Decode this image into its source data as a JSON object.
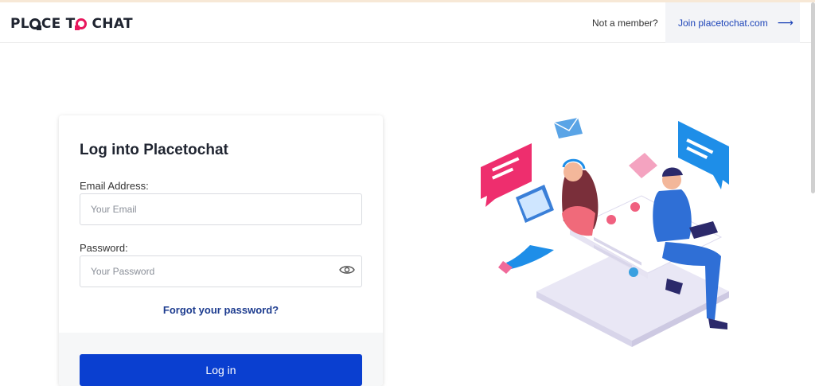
{
  "header": {
    "logo_text": "PLACE TO CHAT",
    "not_member_text": "Not a member?",
    "join_label": "Join placetochat.com",
    "join_arrow": "⟶"
  },
  "login": {
    "title": "Log into Placetochat",
    "email_label": "Email Address:",
    "email_value": "",
    "email_placeholder": "Your Email",
    "password_label": "Password:",
    "password_value": "",
    "password_placeholder": "Your Password",
    "forgot_label": "Forgot your password?",
    "login_label": "Log in"
  },
  "icons": {
    "show_password": "eye-icon",
    "join_arrow": "arrow-right-icon"
  },
  "colors": {
    "primary": "#0a3fd0",
    "link": "#1d3c8f",
    "logo_accent": "#e8175d",
    "text_dark": "#1f2430"
  }
}
